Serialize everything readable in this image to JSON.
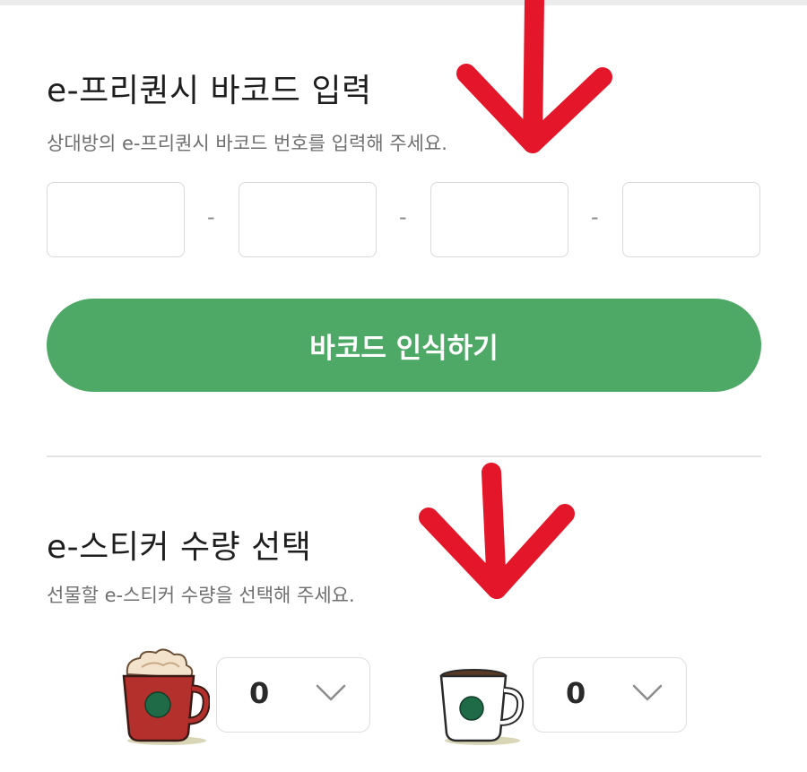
{
  "barcode_section": {
    "title": "e-프리퀀시 바코드 입력",
    "description": "상대방의 e-프리퀀시 바코드 번호를 입력해 주세요.",
    "code_fields": [
      "",
      "",
      "",
      ""
    ],
    "separator": "-",
    "scan_button_label": "바코드 인식하기"
  },
  "sticker_section": {
    "title": "e-스티커 수량 선택",
    "description": "선물할 e-스티커 수량을 선택해 주세요.",
    "items": [
      {
        "icon": "red-cup-with-whipped-cream",
        "selected_quantity": "0"
      },
      {
        "icon": "white-coffee-cup",
        "selected_quantity": "0"
      }
    ]
  },
  "colors": {
    "accent_green": "#4ea866",
    "annotation_arrow": "#e4172a",
    "red_cup": "#b3302c",
    "cup_logo": "#1f6b48"
  }
}
